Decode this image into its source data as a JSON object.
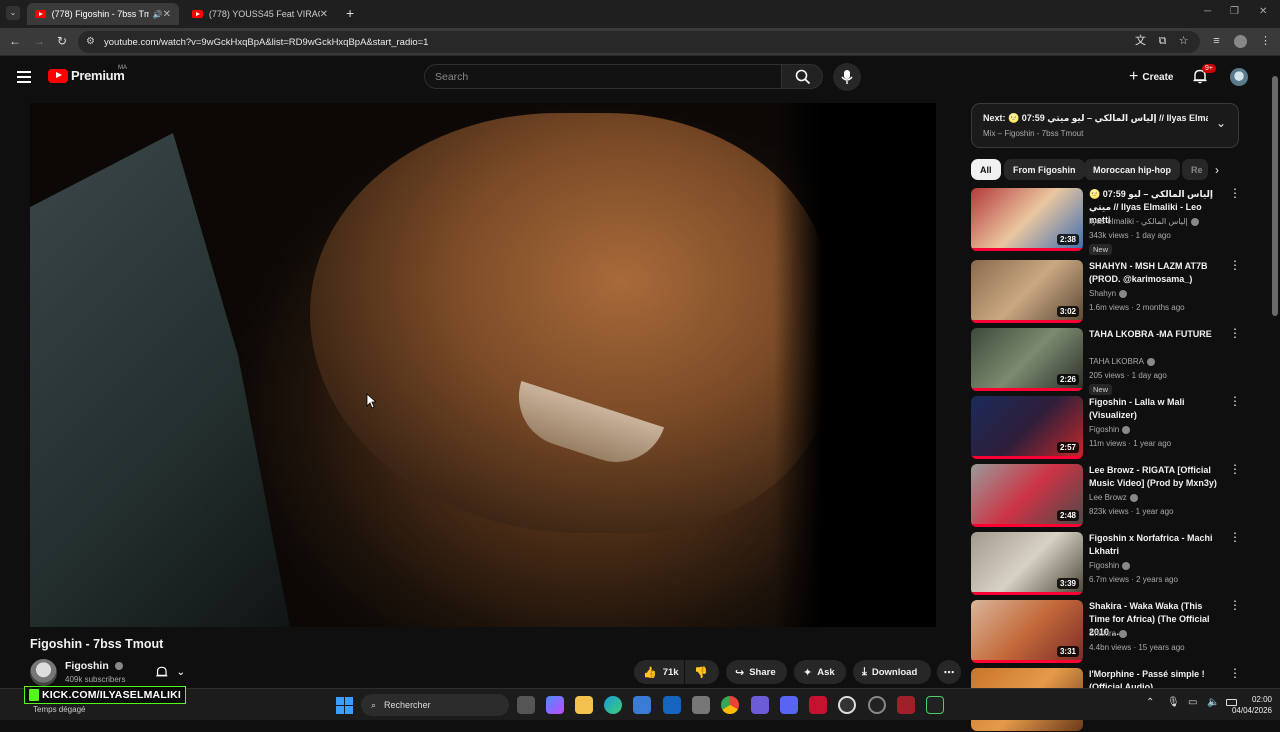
{
  "browser": {
    "tabs": [
      {
        "title": "(778) Figoshin - 7bss Tmout",
        "active": true
      },
      {
        "title": "(778) YOUSS45 Feat VIRACOCH",
        "active": false
      }
    ],
    "url": "youtube.com/watch?v=9wGckHxqBpA&list=RD9wGckHxqBpA&start_radio=1"
  },
  "header": {
    "logo_text": "Premium",
    "logo_region": "MA",
    "search_placeholder": "Search",
    "create_label": "Create",
    "notif_badge": "9+"
  },
  "video": {
    "title": "Figoshin - 7bss Tmout",
    "channel": "Figoshin",
    "subscribers": "409k subscribers",
    "likes": "71k",
    "share_label": "Share",
    "ask_label": "Ask",
    "download_label": "Download"
  },
  "sidebar": {
    "next_label": "Next:",
    "next_title": "🌝 07:59 إلياس المالكي – ليو ميتي // Ilyas Elmaliki - L...",
    "next_subtitle": "Mix – Figoshin - 7bss Tmout",
    "chips": [
      "All",
      "From Figoshin",
      "Moroccan hip-hop",
      "Re"
    ],
    "items": [
      {
        "title": "🌝 07:59 إلياس المالكي – ليو ميتي // Ilyas Elmaliki - Leo metti",
        "channel": "ilyas elmaliki - إلياس المالكي",
        "meta": "343k views · 1 day ago",
        "badge": "New",
        "duration": "2:38",
        "thumb_colors": [
          "#b43a3a",
          "#e9c7a0",
          "#3c6bb0"
        ]
      },
      {
        "title": "SHAHYN - MSH LAZM AT7B (PROD. @karimosama_)",
        "channel": "Shahyn",
        "meta": "1.6m views · 2 months ago",
        "badge": "",
        "duration": "3:02",
        "thumb_colors": [
          "#8a6a4c",
          "#c9a882",
          "#5a4633"
        ]
      },
      {
        "title": "TAHA LKOBRA -MA FUTURE",
        "channel": "TAHA LKOBRA",
        "meta": "205 views · 1 day ago",
        "badge": "New",
        "duration": "2:26",
        "thumb_colors": [
          "#3d4a3a",
          "#7c8a70",
          "#2a2f28"
        ]
      },
      {
        "title": "Figoshin - Lalla w Mali (Visualizer)",
        "channel": "Figoshin",
        "meta": "11m views · 1 year ago",
        "badge": "",
        "duration": "2:57",
        "thumb_colors": [
          "#1a2a5a",
          "#2e1e3a",
          "#c42a2a"
        ]
      },
      {
        "title": "Lee Browz - RIGATA [Official Music Video] (Prod by Mxn3y)",
        "channel": "Lee Browz",
        "meta": "823k views · 1 year ago",
        "badge": "",
        "duration": "2:48",
        "thumb_colors": [
          "#9a9a9a",
          "#cc3344",
          "#4a4a4a"
        ]
      },
      {
        "title": "Figoshin x Norfafrica - Machi Lkhatri",
        "channel": "Figoshin",
        "meta": "6.7m views · 2 years ago",
        "badge": "",
        "duration": "3:39",
        "thumb_colors": [
          "#a29a8c",
          "#d8d2c4",
          "#4a4438"
        ]
      },
      {
        "title": "Shakira - Waka Waka (This Time for Africa) (The Official 2010 ...",
        "channel": "Shakira",
        "meta": "4.4bn views · 15 years ago",
        "badge": "",
        "duration": "3:31",
        "thumb_colors": [
          "#d9b59a",
          "#c46a3a",
          "#7a2a2a"
        ]
      },
      {
        "title": "l'Morphine - Passé simple ! (Official Audio)",
        "channel": "",
        "meta": "",
        "badge": "",
        "duration": "",
        "thumb_colors": [
          "#c9742a",
          "#e59a4a",
          "#6a3a1a"
        ]
      }
    ]
  },
  "overlay": {
    "kick_text": "KICK.COM/ILYASELMALIKI",
    "weather_text": "Temps dégagé"
  },
  "taskbar": {
    "search_label": "Rechercher",
    "time": "02:00",
    "date": "04/04/2026"
  },
  "colors": {
    "bg": "#0f0f0f",
    "accent_red": "#ff0000",
    "progress_red": "#ff0033",
    "kick_green": "#53fc18"
  }
}
